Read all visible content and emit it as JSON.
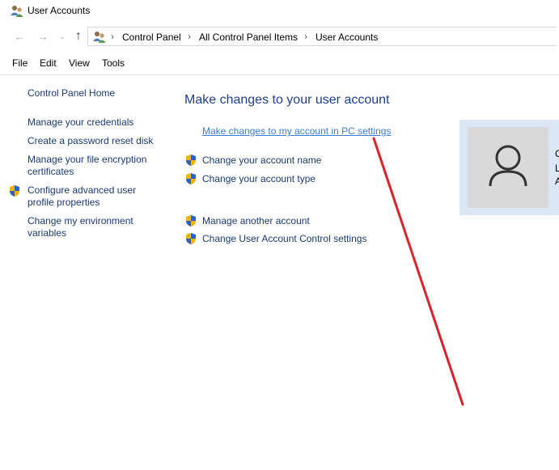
{
  "window": {
    "title": "User Accounts"
  },
  "nav": {
    "back_icon": "back-arrow-icon",
    "forward_icon": "forward-arrow-icon",
    "recent_icon": "chevron-down-icon",
    "up_icon": "up-arrow-icon",
    "breadcrumbs": [
      "Control Panel",
      "All Control Panel Items",
      "User Accounts"
    ]
  },
  "menu": [
    "File",
    "Edit",
    "View",
    "Tools"
  ],
  "sidebar": {
    "home": "Control Panel Home",
    "items": [
      {
        "line1": "Manage your credentials",
        "line2": ""
      },
      {
        "line1": "Create a password reset disk",
        "line2": ""
      },
      {
        "line1": "Manage your file encryption",
        "line2": "certificates"
      },
      {
        "line1": "Configure advanced user",
        "line2": "profile properties",
        "shield": true
      },
      {
        "line1": "Change my environment",
        "line2": "variables"
      }
    ]
  },
  "main": {
    "title": "Make changes to your user account",
    "pc_settings_link": "Make changes to my account in PC settings",
    "links": [
      "Change your account name",
      "Change your account type",
      "Manage another account",
      "Change User Account Control settings"
    ]
  },
  "user_panel": {
    "avatar_icon": "user-avatar-icon",
    "partial_text": [
      "C",
      "L",
      "A"
    ]
  },
  "colors": {
    "link": "#1a3a7a",
    "title": "#1e3f8f",
    "panel_bg": "#dce7f5",
    "annotation": "#e0202a"
  }
}
